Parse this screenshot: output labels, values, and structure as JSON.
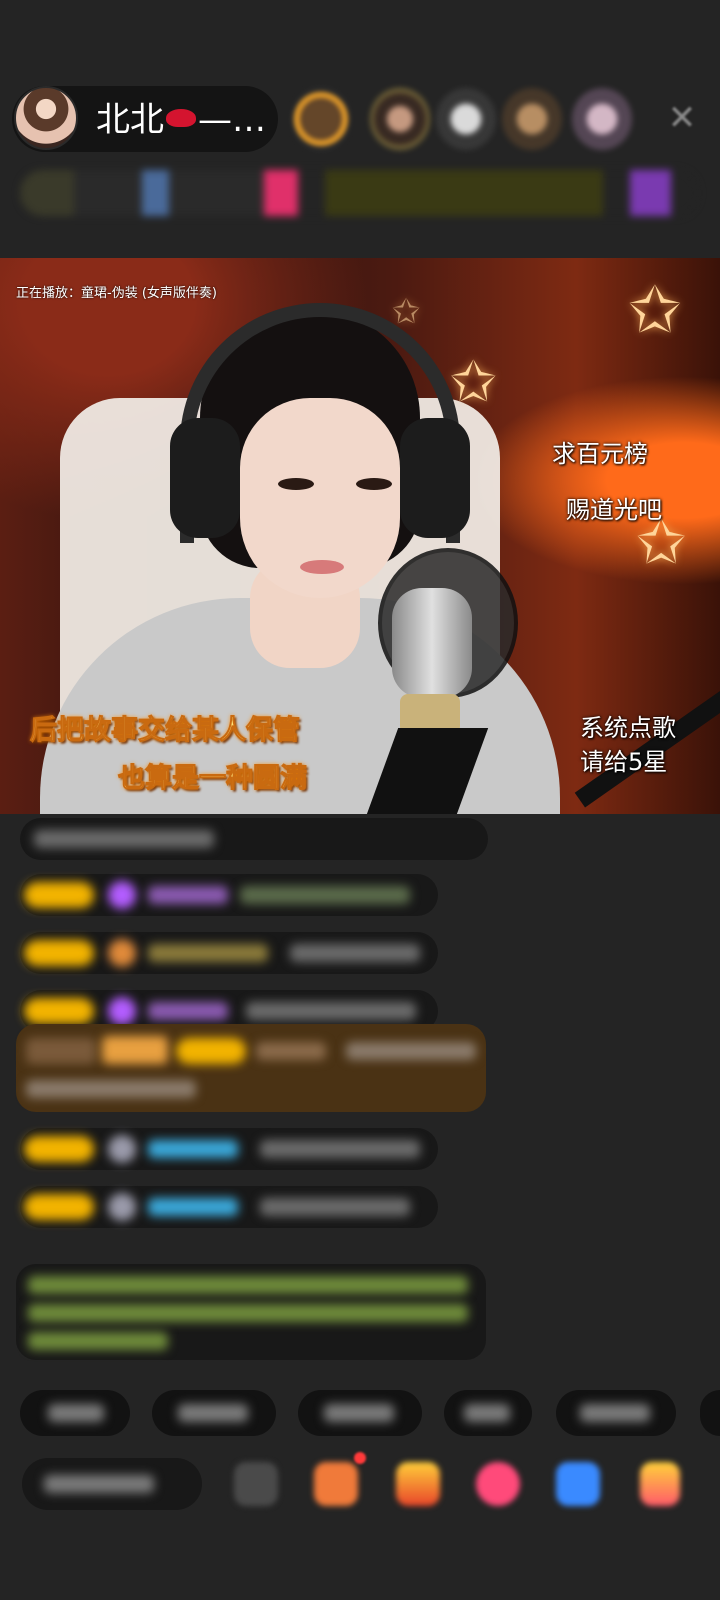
{
  "header": {
    "host_name": "北北",
    "host_name_suffix": "—…",
    "kiss_icon": "kiss-lips-icon",
    "close_icon": "close-icon"
  },
  "video": {
    "now_playing": "正在播放：童珺-伪装 (女声版伴奏)",
    "overlay_lines": [
      "求百元榜",
      "赐道光吧",
      "系统点歌",
      "请给5星"
    ],
    "lyrics": [
      "后把故事交给某人保管",
      "也算是一种圆满"
    ]
  },
  "colors": {
    "lyric_yellow": "#ffe27a",
    "vip_badge": "#f2b300",
    "gift_row_bg": "#4a3214",
    "chat_green": "#9ac64a",
    "chat_blue": "#3aa7d8"
  }
}
